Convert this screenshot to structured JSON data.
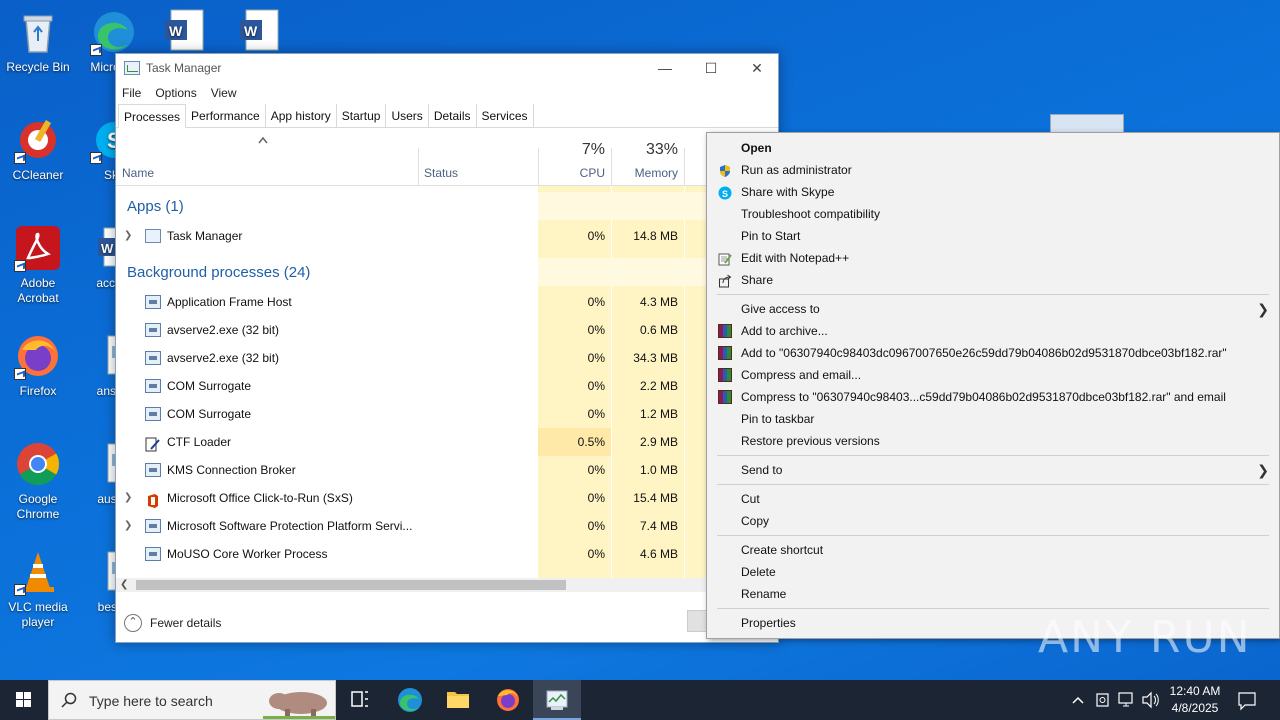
{
  "desktop": {
    "icons_col1": [
      {
        "label": "Recycle Bin"
      },
      {
        "label": "CCleaner"
      },
      {
        "label": "Adobe Acrobat"
      },
      {
        "label": "Firefox"
      },
      {
        "label": "Google Chrome"
      },
      {
        "label": "VLC media player"
      }
    ],
    "icons_col2": [
      {
        "label": "Micro Ed"
      },
      {
        "label": "Sky"
      },
      {
        "label": "accept"
      },
      {
        "label": "answe"
      },
      {
        "label": "austra"
      },
      {
        "label": "bestm"
      }
    ]
  },
  "taskmanager": {
    "title": "Task Manager",
    "menu": [
      "File",
      "Options",
      "View"
    ],
    "tabs": [
      "Processes",
      "Performance",
      "App history",
      "Startup",
      "Users",
      "Details",
      "Services"
    ],
    "active_tab": "Processes",
    "headers": {
      "name": "Name",
      "status": "Status",
      "cpu_pct": "7%",
      "cpu": "CPU",
      "mem_pct": "33%",
      "mem": "Memory"
    },
    "groups": {
      "apps": "Apps (1)",
      "background": "Background processes (24)"
    },
    "apps": [
      {
        "name": "Task Manager",
        "cpu": "0%",
        "mem": "14.8 MB"
      }
    ],
    "background": [
      {
        "name": "Application Frame Host",
        "cpu": "0%",
        "mem": "4.3 MB"
      },
      {
        "name": "avserve2.exe (32 bit)",
        "cpu": "0%",
        "mem": "0.6 MB"
      },
      {
        "name": "avserve2.exe (32 bit)",
        "cpu": "0%",
        "mem": "34.3 MB"
      },
      {
        "name": "COM Surrogate",
        "cpu": "0%",
        "mem": "2.2 MB"
      },
      {
        "name": "COM Surrogate",
        "cpu": "0%",
        "mem": "1.2 MB"
      },
      {
        "name": "CTF Loader",
        "cpu": "0.5%",
        "mem": "2.9 MB"
      },
      {
        "name": "KMS Connection Broker",
        "cpu": "0%",
        "mem": "1.0 MB"
      },
      {
        "name": "Microsoft Office Click-to-Run (SxS)",
        "cpu": "0%",
        "mem": "15.4 MB"
      },
      {
        "name": "Microsoft Software Protection Platform Servi...",
        "cpu": "0%",
        "mem": "7.4 MB"
      },
      {
        "name": "MoUSO Core Worker Process",
        "cpu": "0%",
        "mem": "4.6 MB"
      }
    ],
    "fewer_details": "Fewer details"
  },
  "context_menu": {
    "open": "Open",
    "run_admin": "Run as administrator",
    "share_skype": "Share with Skype",
    "troubleshoot": "Troubleshoot compatibility",
    "pin_start": "Pin to Start",
    "edit_npp": "Edit with Notepad++",
    "share": "Share",
    "give_access": "Give access to",
    "add_archive": "Add to archive...",
    "add_to_rar": "Add to \"06307940c98403dc0967007650e26c59dd79b04086b02d9531870dbce03bf182.rar\"",
    "compress_email": "Compress and email...",
    "compress_to_rar_email": "Compress to \"06307940c98403...c59dd79b04086b02d9531870dbce03bf182.rar\" and email",
    "pin_taskbar": "Pin to taskbar",
    "restore": "Restore previous versions",
    "send_to": "Send to",
    "cut": "Cut",
    "copy": "Copy",
    "create_shortcut": "Create shortcut",
    "delete": "Delete",
    "rename": "Rename",
    "properties": "Properties"
  },
  "watermark": "ANY RUN",
  "taskbar": {
    "search_placeholder": "Type here to search",
    "time": "12:40 AM",
    "date": "4/8/2025"
  },
  "colors": {
    "accent": "#1f5fa8",
    "cpu_col_bg": "#fff4c4",
    "desktop": "#0b6fd8"
  }
}
